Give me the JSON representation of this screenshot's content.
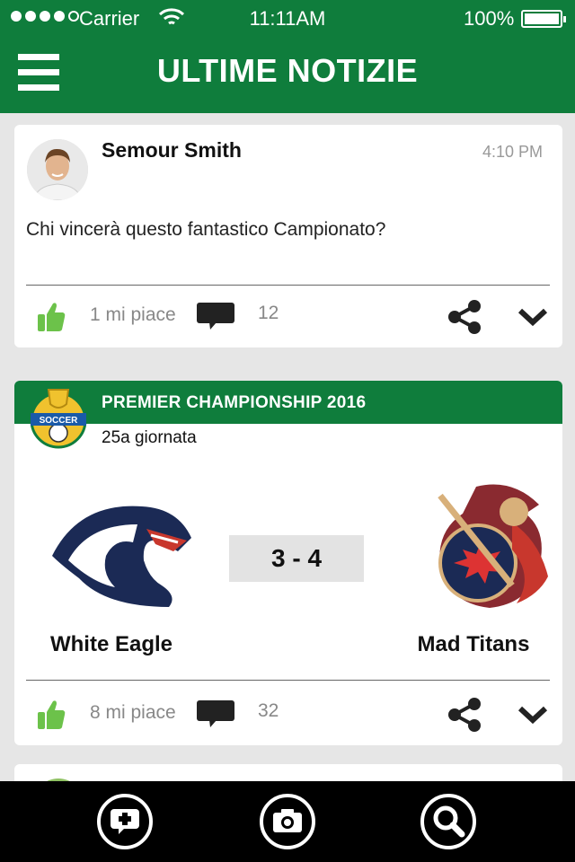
{
  "status_bar": {
    "carrier": "Carrier",
    "time": "11:11AM",
    "battery": "100%"
  },
  "header": {
    "title": "ULTIME NOTIZIE",
    "bg_color": "#0f7d3c"
  },
  "posts": [
    {
      "author": "Semour Smith",
      "time": "4:10 PM",
      "text": "Chi vincerà questo fantastico Campionato?",
      "likes": "1 mi piace",
      "comments": "12"
    }
  ],
  "match_card": {
    "league": "PREMIER CHAMPIONSHIP 2016",
    "league_logo_text": "SOCCER",
    "round": "25a giornata",
    "score": "3 - 4",
    "home_team": "White Eagle",
    "away_team": "Mad Titans",
    "likes": "8 mi piace",
    "comments": "32"
  },
  "footer": {
    "buttons": [
      "new-post-icon",
      "camera-icon",
      "search-icon"
    ]
  },
  "colors": {
    "accent": "#0f7d3c",
    "like": "#6cc24a"
  }
}
